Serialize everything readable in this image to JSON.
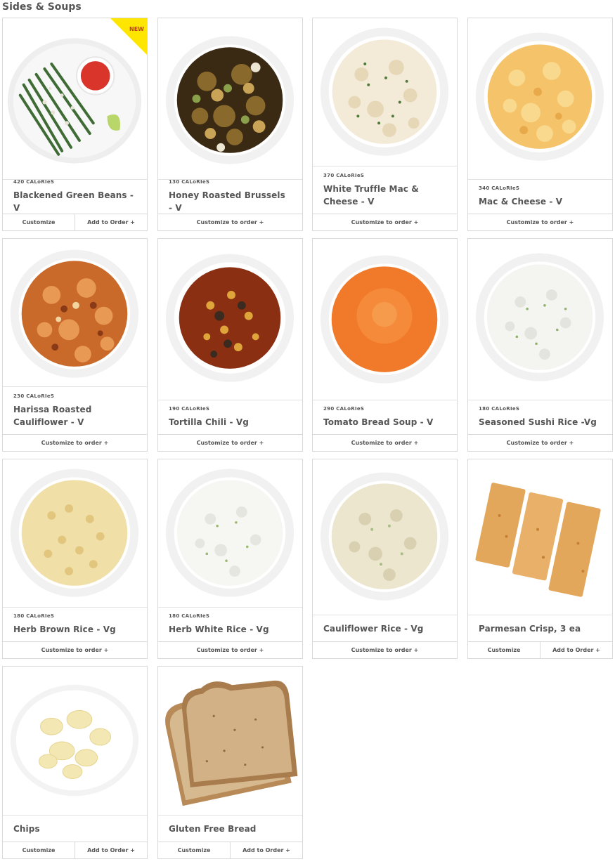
{
  "section": {
    "title": "Sides & Soups"
  },
  "badge": {
    "new_label": "NEW"
  },
  "items": [
    {
      "calories": "420 CALoRIeS",
      "name": "Blackened Green Beans - V",
      "customize": "Customize",
      "add": "Add to Order +"
    },
    {
      "calories": "130 CALoRIeS",
      "name": "Honey Roasted Brussels - V",
      "customize": "Customize to order +"
    },
    {
      "calories": "370 CALoRIeS",
      "name": "White Truffle Mac & Cheese - V",
      "customize": "Customize to order +"
    },
    {
      "calories": "340 CALoRIeS",
      "name": "Mac & Cheese - V",
      "customize": "Customize to order +"
    },
    {
      "calories": "230 CALoRIeS",
      "name": "Harissa Roasted Cauliflower - V",
      "customize": "Customize to order +"
    },
    {
      "calories": "190 CALoRIeS",
      "name": "Tortilla Chili - Vg",
      "customize": "Customize to order +"
    },
    {
      "calories": "290 CALoRIeS",
      "name": "Tomato Bread Soup - V",
      "customize": "Customize to order +"
    },
    {
      "calories": "180 CALoRIeS",
      "name": "Seasoned Sushi Rice -Vg",
      "customize": "Customize to order +"
    },
    {
      "calories": "180 CALoRIeS",
      "name": "Herb Brown Rice - Vg",
      "customize": "Customize to order +"
    },
    {
      "calories": "180 CALoRIeS",
      "name": "Herb White Rice - Vg",
      "customize": "Customize to order +"
    },
    {
      "name": "Cauliflower Rice - Vg",
      "customize": "Customize to order +"
    },
    {
      "name": "Parmesan Crisp, 3 ea",
      "customize": "Customize",
      "add": "Add to Order +"
    },
    {
      "name": "Chips",
      "customize": "Customize",
      "add": "Add to Order +"
    },
    {
      "name": "Gluten Free Bread",
      "customize": "Customize",
      "add": "Add to Order +"
    }
  ]
}
